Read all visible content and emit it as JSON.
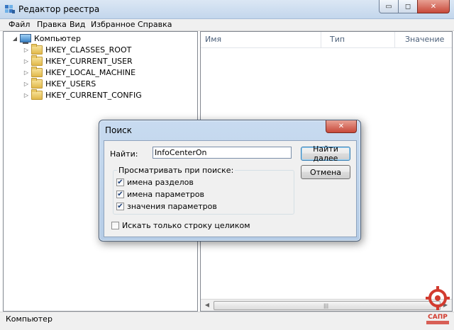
{
  "window": {
    "title": "Редактор реестра",
    "minimize_glyph": "▭",
    "maximize_glyph": "◻",
    "close_glyph": "✕"
  },
  "menu": [
    "Файл",
    "Правка",
    "Вид",
    "Избранное",
    "Справка"
  ],
  "tree": {
    "root": "Компьютер",
    "root_expander": "◢",
    "child_expander": "▷",
    "keys": [
      "HKEY_CLASSES_ROOT",
      "HKEY_CURRENT_USER",
      "HKEY_LOCAL_MACHINE",
      "HKEY_USERS",
      "HKEY_CURRENT_CONFIG"
    ]
  },
  "list": {
    "columns": [
      "Имя",
      "Тип",
      "Значение"
    ],
    "scroll_left": "◀",
    "scroll_right": "▶",
    "grip": "|||"
  },
  "status": "Компьютер",
  "dialog": {
    "title": "Поиск",
    "close_glyph": "✕",
    "find_label": "Найти:",
    "find_value": "InfoCenterOn",
    "find_next": "Найти далее",
    "cancel": "Отмена",
    "group_label": "Просматривать при поиске:",
    "options": [
      {
        "label": "имена разделов",
        "checked": true
      },
      {
        "label": "имена параметров",
        "checked": true
      },
      {
        "label": "значения параметров",
        "checked": true
      }
    ],
    "whole_string": {
      "label": "Искать только строку целиком",
      "checked": false
    },
    "check_glyph": "✔"
  },
  "watermark": {
    "text": "САПР"
  },
  "colors": {
    "accent": "#3c7fb1",
    "close": "#c8493a",
    "watermark": "#d23b2f"
  }
}
